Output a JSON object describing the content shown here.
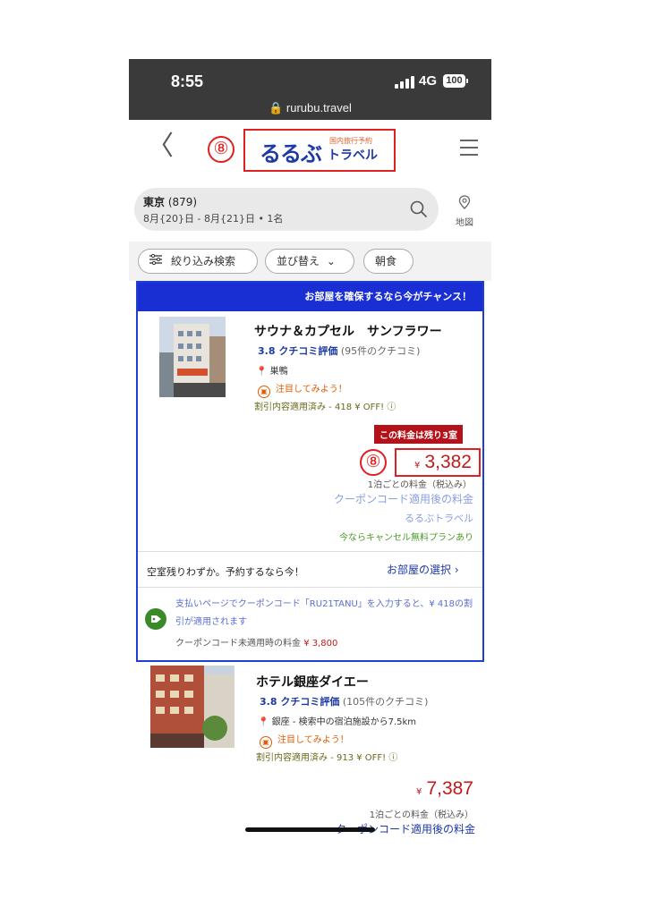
{
  "status_bar": {
    "time": "8:55",
    "network": "4G",
    "battery": "100",
    "url": "rurubu.travel"
  },
  "header": {
    "back_glyph": "〈",
    "annotation_marker": "⑧",
    "logo_main": "るるぶ",
    "logo_tagline": "国内旅行予約",
    "logo_sub": "トラベル"
  },
  "search": {
    "city": "東京",
    "count": "(879)",
    "dates": "8月{20}日 - 8月{21}日 • 1名",
    "map_label": "地図"
  },
  "filters": [
    {
      "label": "絞り込み検索"
    },
    {
      "label": "並び替え"
    },
    {
      "label": "朝食"
    }
  ],
  "hotels": [
    {
      "promo": "お部屋を確保するなら今がチャンス！",
      "name": "サウナ＆カプセル　サンフラワー",
      "rating": "3.8 クチコミ評価",
      "reviews": "(95件のクチコミ)",
      "location": "巣鴨",
      "attention": "注目してみよう！",
      "discount": "割引内容適用済み - 418 ¥ OFF! ⓘ",
      "badge": "この料金は残り3室",
      "annotation_marker": "⑧",
      "currency": "¥",
      "price": "3,382",
      "per_night": "1泊ごとの料金（税込み）",
      "coupon_label": "クーポンコード適用後の料金",
      "vendor": "るるぶトラベル",
      "cancel": "今ならキャンセル無料プランあり",
      "few_rooms": "空室残りわずか。予約するなら今！",
      "select_room": "お部屋の選択 ›",
      "coupon_text": "支払いページでクーポンコード「RU21TANU」を入力すると、¥ 418の割引が適用されます",
      "coupon_old_label": "クーポンコード未適用時の料金",
      "coupon_old_price": "¥ 3,800"
    },
    {
      "name": "ホテル銀座ダイエー",
      "rating": "3.8 クチコミ評価",
      "reviews": "(105件のクチコミ)",
      "location": "銀座 - 検索中の宿泊施設から7.5km",
      "attention": "注目してみよう！",
      "discount": "割引内容適用済み - 913 ¥ OFF! ⓘ",
      "currency": "¥",
      "price": "7,387",
      "per_night": "1泊ごとの料金（税込み）",
      "coupon_label": "クーポンコード適用後の料金"
    }
  ]
}
